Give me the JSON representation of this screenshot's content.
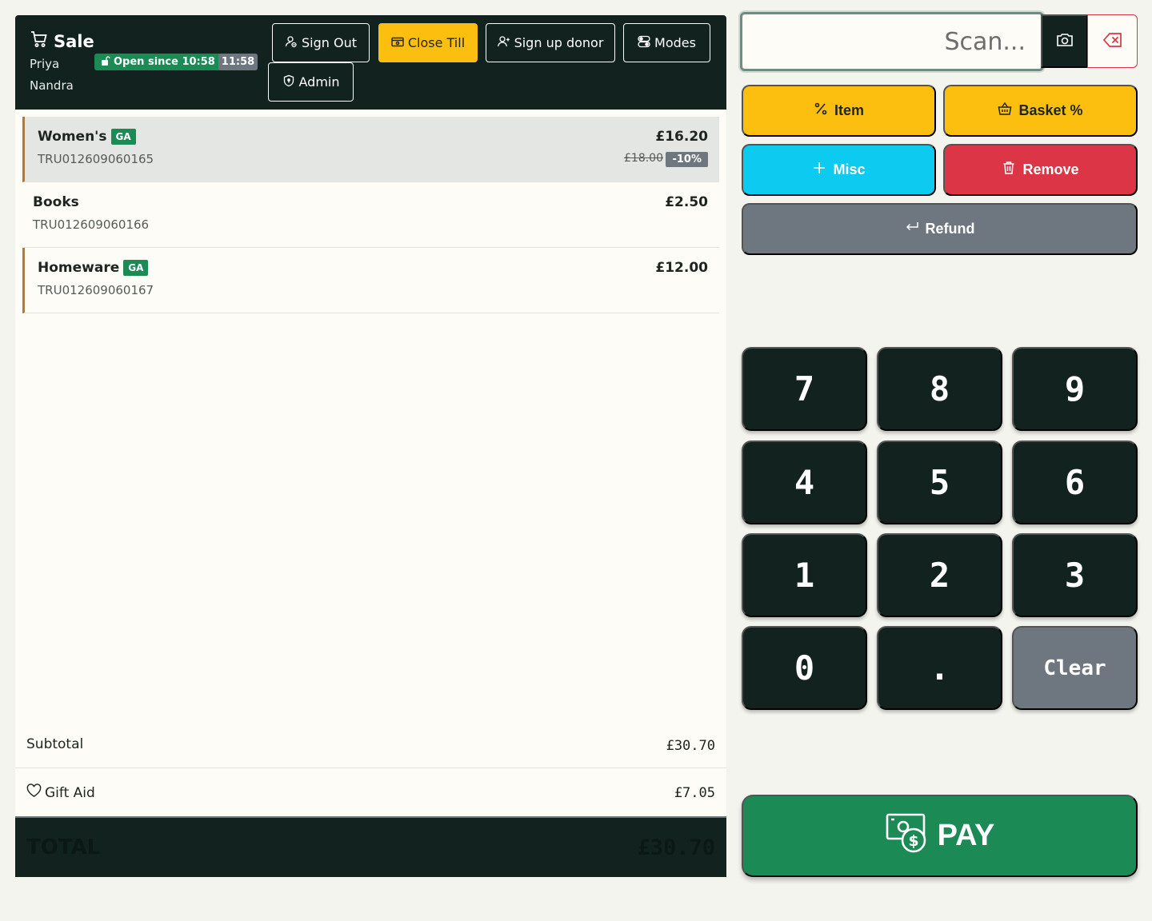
{
  "header": {
    "title": "Sale",
    "user_first": "Priya",
    "user_last": "Nandra",
    "open_badge": "Open since 10:58",
    "clock": "11:58",
    "buttons": {
      "sign_out": "Sign Out",
      "close_till": "Close Till",
      "sign_up_donor": "Sign up donor",
      "modes": "Modes",
      "admin": "Admin"
    }
  },
  "basket": {
    "items": [
      {
        "name": "Women's",
        "gift_aid": "GA",
        "code": "TRU012609060165",
        "price": "£16.20",
        "original_price": "£18.00",
        "discount": "-10%"
      },
      {
        "name": "Books",
        "code": "TRU012609060166",
        "price": "£2.50"
      },
      {
        "name": "Homeware",
        "gift_aid": "GA",
        "code": "TRU012609060167",
        "price": "£12.00"
      }
    ]
  },
  "summary": {
    "subtotal_label": "Subtotal",
    "subtotal_value": "£30.70",
    "gift_aid_label": "Gift Aid",
    "gift_aid_value": "£7.05",
    "total_label": "TOTAL",
    "total_value": "£30.70"
  },
  "scan": {
    "placeholder": "Scan..."
  },
  "actions": {
    "item_discount": "Item",
    "basket_discount": "Basket %",
    "misc": "Misc",
    "remove": "Remove",
    "refund": "Refund"
  },
  "keypad": {
    "keys": [
      "7",
      "8",
      "9",
      "4",
      "5",
      "6",
      "1",
      "2",
      "3",
      "0",
      ".",
      "Clear"
    ]
  },
  "pay": {
    "label": "PAY"
  },
  "colors": {
    "header_bg": "#12231f",
    "accent_yellow": "#fcbf0f",
    "accent_cyan": "#0dcaf0",
    "accent_red": "#dc3545",
    "accent_gray": "#6e7780",
    "brand_green": "#1b8a55"
  }
}
